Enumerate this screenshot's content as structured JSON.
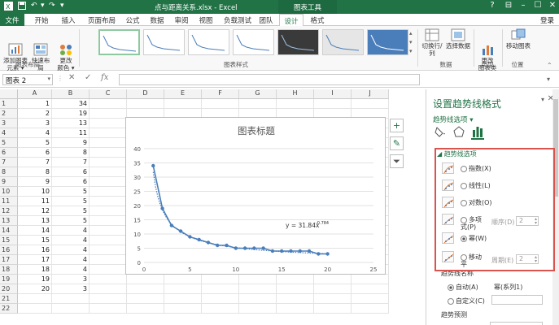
{
  "title_bar": {
    "file_title": "点与距离关系.xlsx - Excel",
    "context_tab": "图表工具",
    "help": "?",
    "min": "–",
    "max": "☐",
    "close": "✕"
  },
  "tabs": [
    "文件",
    "开始",
    "插入",
    "页面布局",
    "公式",
    "数据",
    "审阅",
    "视图",
    "负载测试",
    "团队",
    "设计",
    "格式"
  ],
  "active_tab": "设计",
  "login": "登录",
  "ribbon": {
    "add_element": "添加图表\n元素 ▾",
    "quick_layout": "快速布局\n▾",
    "change_colors": "更改\n颜色 ▾",
    "group_layout": "图表布局",
    "group_styles": "图表样式",
    "switch_rowcol": "切换行/列",
    "select_data": "选择数据",
    "group_data": "数据",
    "change_type": "更改\n图表类型",
    "group_type": "类型",
    "move_chart": "移动图表",
    "group_location": "位置"
  },
  "formula_bar": {
    "name_box": "图表 2",
    "cancel": "✕",
    "enter": "✓",
    "fx": "fx",
    "content": ""
  },
  "grid": {
    "columns": [
      "A",
      "B",
      "C",
      "D",
      "E",
      "F",
      "G",
      "H",
      "I",
      "J"
    ],
    "rows": [
      [
        1,
        34
      ],
      [
        2,
        19
      ],
      [
        3,
        13
      ],
      [
        4,
        11
      ],
      [
        5,
        9
      ],
      [
        6,
        8
      ],
      [
        7,
        7
      ],
      [
        8,
        6
      ],
      [
        9,
        6
      ],
      [
        10,
        5
      ],
      [
        11,
        5
      ],
      [
        12,
        5
      ],
      [
        13,
        5
      ],
      [
        14,
        4
      ],
      [
        15,
        4
      ],
      [
        16,
        4
      ],
      [
        17,
        4
      ],
      [
        18,
        4
      ],
      [
        19,
        3
      ],
      [
        20,
        3
      ]
    ],
    "row_numbers": [
      "1",
      "2",
      "3",
      "4",
      "5",
      "6",
      "7",
      "8",
      "9",
      "10",
      "11",
      "12",
      "13",
      "14",
      "15",
      "16",
      "17",
      "18",
      "19",
      "20",
      "21",
      "22"
    ]
  },
  "chart_data": {
    "type": "scatter",
    "title": "图表标题",
    "x": [
      1,
      2,
      3,
      4,
      5,
      6,
      7,
      8,
      9,
      10,
      11,
      12,
      13,
      14,
      15,
      16,
      17,
      18,
      19,
      20
    ],
    "y": [
      34,
      19,
      13,
      11,
      9,
      8,
      7,
      6,
      6,
      5,
      5,
      5,
      5,
      4,
      4,
      4,
      4,
      4,
      3,
      3
    ],
    "xlim": [
      0,
      25
    ],
    "ylim": [
      0,
      40
    ],
    "xticks": [
      "0",
      "5",
      "10",
      "15",
      "20",
      "25"
    ],
    "yticks": [
      "0",
      "5",
      "10",
      "15",
      "20",
      "25",
      "30",
      "35",
      "40"
    ],
    "trendline": {
      "type": "power",
      "coef": 31.84,
      "exp": -0.784,
      "label": "y = 31.84x",
      "label_exp": "-0.784"
    },
    "series_color": "#4a7ebb",
    "grid": true
  },
  "chart_side_buttons": {
    "add": "+",
    "style": "✎",
    "filter": "⏷"
  },
  "pane": {
    "title": "设置趋势线格式",
    "close": "✕",
    "dropdown": "▾",
    "subtitle": "趋势线选项 ▾",
    "section": "◢ 趋势线选项",
    "options": [
      {
        "label": "指数(X)",
        "checked": false
      },
      {
        "label": "线性(L)",
        "checked": false
      },
      {
        "label": "对数(O)",
        "checked": false
      },
      {
        "label": "多项\n式(P)",
        "checked": false
      },
      {
        "label": "幂(W)",
        "checked": true
      },
      {
        "label": "移动\n平",
        "checked": false
      }
    ],
    "order_label": "顺序(D)",
    "order_value": "2",
    "period_label": "周期(E)",
    "period_value": "2",
    "name_heading": "趋势线名称",
    "auto_label": "自动(A)",
    "auto_value": "幂(系列1)",
    "custom_label": "自定义(C)",
    "forecast_heading": "趋势预测"
  }
}
